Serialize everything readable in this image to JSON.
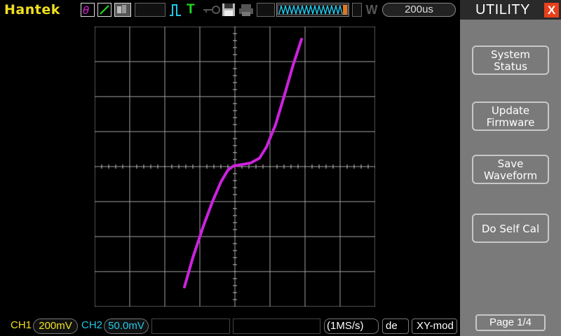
{
  "top_bar": {
    "brand": "Hantek",
    "trigger_edge_label": "⎍",
    "trigger_mode_label": "T",
    "timebase": "200us",
    "waveform_mode_letter": "W",
    "colors": {
      "brand": "#f0e020",
      "trigger": "#20c8e8",
      "icon_magenta": "#e020e0"
    }
  },
  "display": {
    "mode": "XY",
    "trace_color": "#cc22dd",
    "grid_divisions": {
      "x": 8,
      "y": 8
    }
  },
  "bottom_bar": {
    "ch1_label": "CH1",
    "ch1_value": "200mV",
    "ch2_label": "CH2",
    "ch2_value": "50.0mV",
    "sample_rate": "(1MS/s)",
    "mode_partial": "de",
    "display_mode": "XY-mod",
    "colors": {
      "ch1": "#f0e020",
      "ch2": "#20c8e8"
    }
  },
  "panel": {
    "title": "UTILITY",
    "close_glyph": "X",
    "buttons": [
      {
        "line1": "System",
        "line2": "Status"
      },
      {
        "line1": "Update",
        "line2": "Firmware"
      },
      {
        "line1": "Save",
        "line2": "Waveform"
      },
      {
        "line1": "Do Self Cal",
        "line2": ""
      }
    ],
    "page_label": "Page 1/4"
  }
}
